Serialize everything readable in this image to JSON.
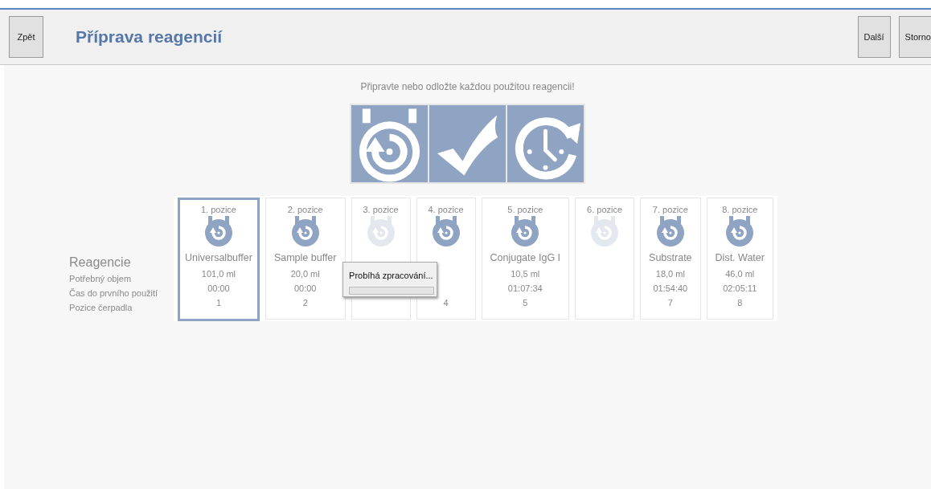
{
  "header": {
    "back_button": "Zpět",
    "title": "Příprava reagencií",
    "next_button": "Další",
    "cancel_button": "Storno"
  },
  "instruction": "Připravte nebo odložte každou použitou  reagencii!",
  "row_labels": {
    "heading": "Reagencie",
    "volume": "Potřebný objem",
    "time": "Čas do prvního použití",
    "pump": "Pozice čerpadla"
  },
  "positions": [
    {
      "label": "1. pozice",
      "enabled": true,
      "selected": true,
      "name": "Universalbuffer",
      "volume": "101,0 ml",
      "time": "00:00",
      "pump": "1"
    },
    {
      "label": "2. pozice",
      "enabled": true,
      "selected": false,
      "name": "Sample buffer",
      "volume": "20,0 ml",
      "time": "00:00",
      "pump": "2"
    },
    {
      "label": "3. pozice",
      "enabled": false,
      "selected": false
    },
    {
      "label": "4. pozice",
      "enabled": true,
      "selected": false,
      "pump": "4"
    },
    {
      "label": "5. pozice",
      "enabled": true,
      "selected": false,
      "name": "Conjugate IgG I",
      "volume": "10,5 ml",
      "time": "01:07:34",
      "pump": "5"
    },
    {
      "label": "6. pozice",
      "enabled": false,
      "selected": false
    },
    {
      "label": "7. pozice",
      "enabled": true,
      "selected": false,
      "name": "Substrate",
      "volume": "18,0 ml",
      "time": "01:54:40",
      "pump": "7"
    },
    {
      "label": "8. pozice",
      "enabled": true,
      "selected": false,
      "name": "Dist. Water",
      "volume": "46,0 ml",
      "time": "02:05:11",
      "pump": "8"
    }
  ],
  "progress_dialog": {
    "message": "Probíhá zpracování..."
  }
}
